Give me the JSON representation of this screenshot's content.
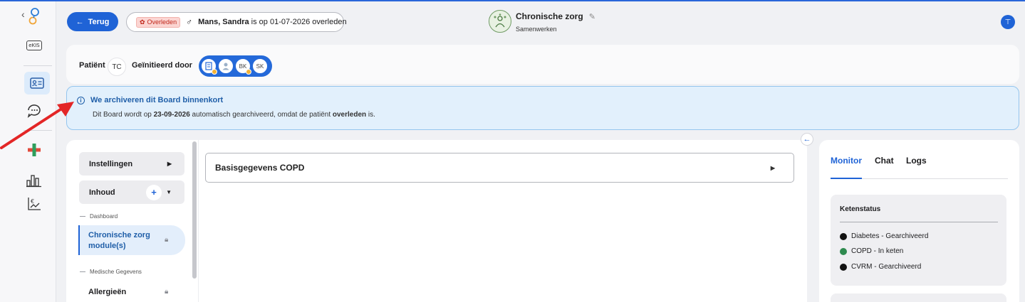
{
  "header": {
    "back_label": "Terug",
    "deceased_badge": "Overleden",
    "gender_symbol": "♂",
    "patient_name": "Mans, Sandra",
    "deceased_text": "is op 01-07-2026 overleden",
    "board_title": "Chronische zorg",
    "board_subtitle": "Samenwerken"
  },
  "rail": {
    "ekis_label": "eKIS"
  },
  "patient_bar": {
    "patient_label": "Patiënt",
    "patient_initials": "TC",
    "initiated_label": "Geïnitieerd door",
    "initiators": [
      "BK",
      "SK"
    ]
  },
  "alert": {
    "title": "We archiveren dit Board binnenkort",
    "body_prefix": "Dit Board wordt op ",
    "body_date": "23-09-2026",
    "body_middle": " automatisch gearchiveerd, omdat de patiënt ",
    "body_reason": "overleden",
    "body_suffix": " is."
  },
  "sidebar": {
    "settings_label": "Instellingen",
    "content_label": "Inhoud",
    "section_dashboard": "Dashboard",
    "active_item": "Chronische zorg module(s)",
    "section_medical": "Medische Gegevens",
    "allergies_label": "Allergieën"
  },
  "main": {
    "accordion_title": "Basisgegevens COPD"
  },
  "right_panel": {
    "tabs": [
      "Monitor",
      "Chat",
      "Logs"
    ],
    "chain_title": "Ketenstatus",
    "chain_items": [
      {
        "label": "Diabetes - Gearchiveerd",
        "color": "#111111"
      },
      {
        "label": "COPD - In keten",
        "color": "#2e8a4f"
      },
      {
        "label": "CVRM - Gearchiveerd",
        "color": "#111111"
      }
    ]
  },
  "colors": {
    "primary": "#1f63d6",
    "alert_bg": "#e2f0fc",
    "deceased_red": "#c0271a"
  }
}
